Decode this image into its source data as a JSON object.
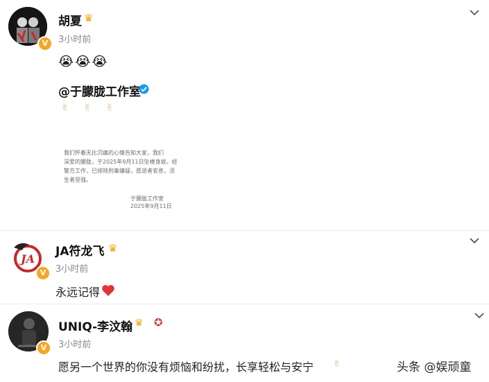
{
  "colors": {
    "badge": "#f5a623",
    "heart": "#e03535",
    "verified": "#1d9bf0"
  },
  "icons": [
    "crown-icon",
    "verified-badge-icon",
    "chevron-down-icon",
    "heart-icon",
    "hand-icon",
    "crying-face-icon"
  ],
  "posts": [
    {
      "username": "胡夏",
      "time": "3小时前",
      "emojis": "😭😭😭",
      "mention": "@于朦胧工作室",
      "hands": "✌ ✌ ✌",
      "statement": {
        "lines": [
          "我们怀着无比沉痛的心情告知大家，我们",
          "深爱的朦胧，于2025年9月11日坠楼身故。经",
          "警方工作，已排除刑事嫌疑，愿逝者安息，活",
          "生者坚强。"
        ],
        "signature": "于朦胧工作室",
        "date": "2025年9月11日"
      }
    },
    {
      "username": "JA符龙飞",
      "time": "3小时前",
      "content": "永远记得"
    },
    {
      "username": "UNIQ-李汶翰",
      "time": "3小时前",
      "content": "愿另一个世界的你没有烦恼和纷扰，长享轻松与安宁"
    }
  ],
  "watermark": "头条 @娱顽童"
}
